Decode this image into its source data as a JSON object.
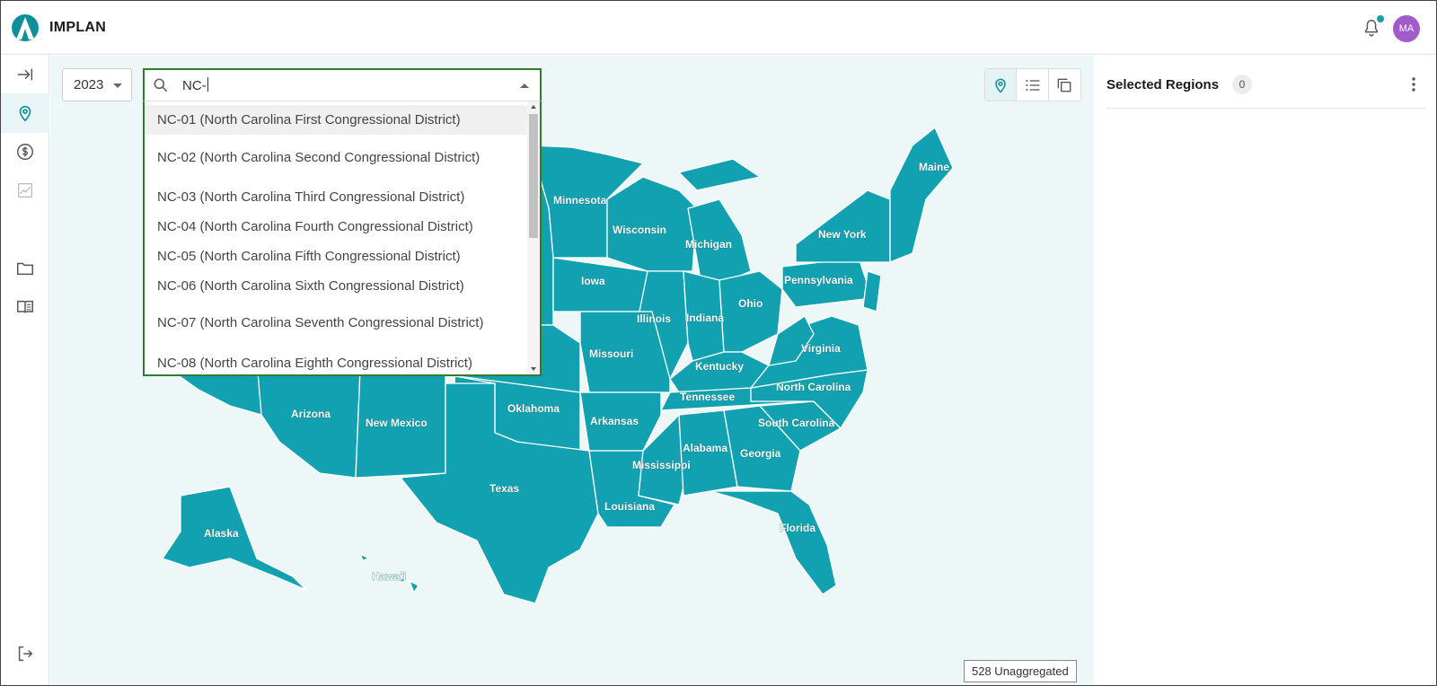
{
  "header": {
    "brand": "IMPLAN",
    "avatar_initials": "MA",
    "notification_dot_color": "#1a9fa8",
    "avatar_color": "#a05cc8"
  },
  "rail": {
    "items": [
      {
        "name": "expand",
        "icon": "arrow-right-bar-icon"
      },
      {
        "name": "regions",
        "icon": "map-pin-icon",
        "active": true
      },
      {
        "name": "economics",
        "icon": "dollar-circle-icon"
      },
      {
        "name": "analytics",
        "icon": "chart-icon"
      },
      {
        "name": "projects",
        "icon": "folder-icon"
      },
      {
        "name": "library",
        "icon": "book-icon"
      }
    ],
    "bottom_icon": "logout-icon"
  },
  "toolbar": {
    "year": "2023",
    "search_value": "NC-",
    "dropdown_items": [
      "NC-01 (North Carolina First Congressional District)",
      "NC-02 (North Carolina Second Congressional District)",
      "NC-03 (North Carolina Third Congressional District)",
      "NC-04 (North Carolina Fourth Congressional District)",
      "NC-05 (North Carolina Fifth Congressional District)",
      "NC-06 (North Carolina Sixth Congressional District)",
      "NC-07 (North Carolina Seventh Congressional District)",
      "NC-08 (North Carolina Eighth Congressional District)"
    ],
    "views": [
      "map-view",
      "list-view",
      "layers-view"
    ],
    "active_view": "map-view"
  },
  "map": {
    "fill_color": "#12a1b0",
    "background": "#eef7f8",
    "state_labels": [
      "Maine",
      "Minnesota",
      "Wisconsin",
      "Michigan",
      "New York",
      "Iowa",
      "Pennsylvania",
      "Illinois",
      "Indiana",
      "Ohio",
      "Missouri",
      "Virginia",
      "Kentucky",
      "Tennessee",
      "North Carolina",
      "Arizona",
      "New Mexico",
      "Oklahoma",
      "Arkansas",
      "South Carolina",
      "Alabama",
      "Georgia",
      "Mississippi",
      "Texas",
      "Louisiana",
      "Florida",
      "Alaska",
      "Hawaii"
    ],
    "unaggregated_label": "528 Unaggregated"
  },
  "panel": {
    "title": "Selected Regions",
    "count": "0"
  }
}
